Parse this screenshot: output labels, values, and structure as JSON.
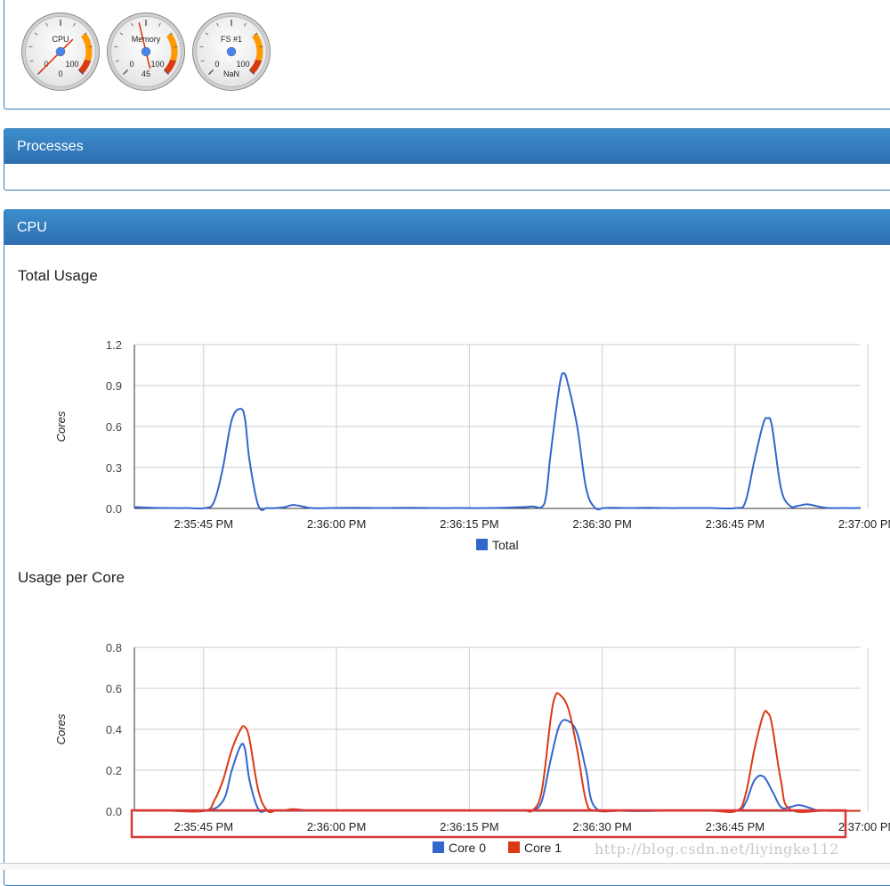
{
  "gauges": [
    {
      "label": "CPU",
      "min": "0",
      "max": "100",
      "value_text": "0",
      "value": 0
    },
    {
      "label": "Memory",
      "min": "0",
      "max": "100",
      "value_text": "45",
      "value": 45
    },
    {
      "label": "FS #1",
      "min": "0",
      "max": "100",
      "value_text": "NaN",
      "value": null
    }
  ],
  "panels": {
    "processes": {
      "title": "Processes"
    },
    "cpu": {
      "title": "CPU"
    }
  },
  "colors": {
    "panel_heading": "#337ab7",
    "core0": "#3366cc",
    "core1": "#dc3912",
    "highlight": "#d9383a"
  },
  "watermark": "http://blog.csdn.net/liyingke112",
  "chart_data": [
    {
      "type": "line",
      "title": "Total Usage",
      "ylabel": "Cores",
      "xlabel": "",
      "ylim": [
        0,
        1.2
      ],
      "yticks": [
        "0.0",
        "0.3",
        "0.6",
        "0.9",
        "1.2"
      ],
      "ytick_values": [
        0,
        0.3,
        0.6,
        0.9,
        1.2
      ],
      "xlim": [
        0,
        82
      ],
      "xticks": [
        "2:35:45 PM",
        "2:36:00 PM",
        "2:36:15 PM",
        "2:36:30 PM",
        "2:36:45 PM",
        "2:37:00 PM"
      ],
      "xtick_values": [
        4,
        19,
        34,
        49,
        64,
        79
      ],
      "grid": true,
      "legend_position": "bottom",
      "series": [
        {
          "name": "Total",
          "color": "#3366cc",
          "x": [
            0,
            2,
            4,
            6,
            8,
            9,
            10,
            11,
            12,
            12.5,
            13,
            14,
            15,
            16,
            17,
            18,
            20,
            22,
            25,
            28,
            31,
            34,
            37,
            40,
            43,
            44,
            45,
            46,
            46.5,
            47,
            48,
            48.5,
            49,
            50,
            51,
            52,
            53,
            54,
            56,
            58,
            60,
            62,
            65,
            68,
            69,
            70,
            71,
            71.5,
            72,
            73,
            74,
            75,
            76,
            78,
            80,
            82
          ],
          "y": [
            0.01,
            0.005,
            0.003,
            0.003,
            0.003,
            0.05,
            0.3,
            0.65,
            0.73,
            0.65,
            0.35,
            0.02,
            0.003,
            0.003,
            0.01,
            0.025,
            0.003,
            0.003,
            0.005,
            0.003,
            0.005,
            0.003,
            0.003,
            0.003,
            0.008,
            0.01,
            0.015,
            0.01,
            0.1,
            0.4,
            0.9,
            0.99,
            0.9,
            0.6,
            0.15,
            0.005,
            0.003,
            0.005,
            0.003,
            0.005,
            0.003,
            0.003,
            0.003,
            0.003,
            0.05,
            0.35,
            0.62,
            0.66,
            0.6,
            0.15,
            0.02,
            0.02,
            0.03,
            0.005,
            0.003,
            0.003
          ]
        }
      ]
    },
    {
      "type": "line",
      "title": "Usage per Core",
      "ylabel": "Cores",
      "xlabel": "",
      "ylim": [
        0,
        0.8
      ],
      "yticks": [
        "0.0",
        "0.2",
        "0.4",
        "0.6",
        "0.8"
      ],
      "ytick_values": [
        0,
        0.2,
        0.4,
        0.6,
        0.8
      ],
      "xlim": [
        0,
        82
      ],
      "xticks": [
        "2:35:45 PM",
        "2:36:00 PM",
        "2:36:15 PM",
        "2:36:30 PM",
        "2:36:45 PM",
        "2:37:00 PM"
      ],
      "xtick_values": [
        4,
        19,
        34,
        49,
        64,
        79
      ],
      "grid": true,
      "legend_position": "bottom",
      "series": [
        {
          "name": "Core 0",
          "color": "#3366cc",
          "x": [
            0,
            4,
            8,
            10,
            11,
            12,
            12.5,
            13,
            14,
            15,
            18,
            20,
            25,
            30,
            35,
            40,
            44,
            45,
            46,
            47,
            48,
            49,
            50,
            51,
            52,
            55,
            60,
            65,
            68,
            69,
            70,
            71,
            72,
            73,
            74,
            75,
            76,
            77,
            78,
            82
          ],
          "y": [
            0.003,
            0.002,
            0.002,
            0.05,
            0.2,
            0.32,
            0.3,
            0.15,
            0.01,
            0.002,
            0.005,
            0.002,
            0.002,
            0.002,
            0.002,
            0.002,
            0.003,
            0.005,
            0.05,
            0.25,
            0.42,
            0.44,
            0.38,
            0.2,
            0.02,
            0.002,
            0.002,
            0.002,
            0.002,
            0.04,
            0.15,
            0.17,
            0.1,
            0.02,
            0.02,
            0.03,
            0.02,
            0.005,
            0.002,
            0.002
          ]
        },
        {
          "name": "Core 1",
          "color": "#dc3912",
          "x": [
            0,
            4,
            8,
            9,
            10,
            11,
            12,
            12.5,
            13,
            14,
            15,
            16,
            17,
            18,
            20,
            25,
            30,
            35,
            40,
            43,
            44,
            45,
            46,
            47,
            47.5,
            48,
            49,
            50,
            51,
            52,
            55,
            60,
            65,
            68,
            69,
            70,
            71,
            71.5,
            72,
            73,
            74,
            78,
            82
          ],
          "y": [
            0.003,
            0.002,
            0.002,
            0.05,
            0.15,
            0.3,
            0.4,
            0.41,
            0.35,
            0.1,
            0.003,
            0.003,
            0.005,
            0.01,
            0.003,
            0.002,
            0.002,
            0.002,
            0.002,
            0.003,
            0.005,
            0.005,
            0.1,
            0.45,
            0.56,
            0.57,
            0.5,
            0.3,
            0.05,
            0.003,
            0.002,
            0.002,
            0.002,
            0.002,
            0.08,
            0.3,
            0.47,
            0.48,
            0.42,
            0.15,
            0.01,
            0.002,
            0.002
          ]
        }
      ]
    }
  ]
}
